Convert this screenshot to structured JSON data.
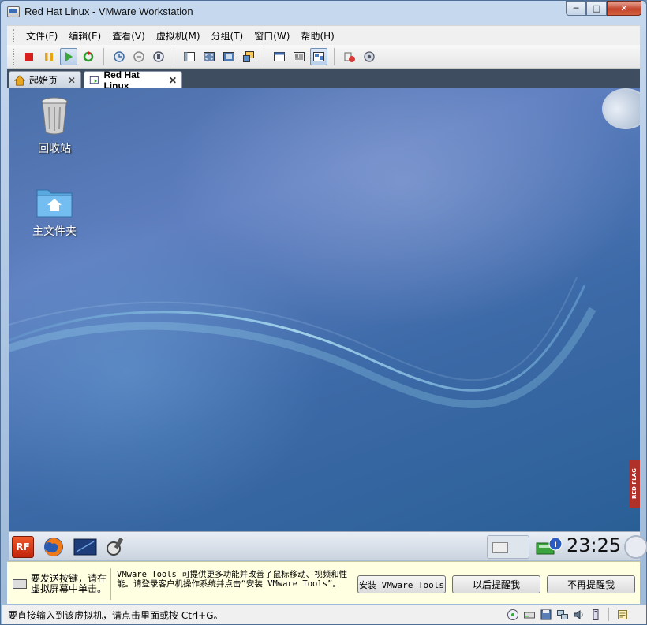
{
  "window": {
    "title": "Red Hat Linux - VMware Workstation",
    "minimize": "─",
    "maximize": "□",
    "close": "✕"
  },
  "menu": {
    "items": [
      "文件(F)",
      "编辑(E)",
      "查看(V)",
      "虚拟机(M)",
      "分组(T)",
      "窗口(W)",
      "帮助(H)"
    ]
  },
  "tabs": [
    {
      "label": "起始页",
      "close": "✕",
      "icon": "home-icon"
    },
    {
      "label": "Red Hat Linux",
      "close": "✕",
      "icon": "vm-icon"
    }
  ],
  "desktop": {
    "icons": [
      {
        "label": "回收站",
        "icon": "trash-icon"
      },
      {
        "label": "主文件夹",
        "icon": "home-folder-icon"
      }
    ],
    "side_tab": "RED FLAG"
  },
  "guest_taskbar": {
    "start": "RF",
    "clock": "23:25"
  },
  "notification": {
    "hint": "要发送按键，请在虚拟屏幕中单击。",
    "message": "VMware Tools 可提供更多功能并改善了鼠标移动、视频和性能。请登录客户机操作系统并点击“安装 VMware Tools”。",
    "install_button": "安装 VMware Tools",
    "later_button": "以后提醒我",
    "never_button": "不再提醒我"
  },
  "status": {
    "text": "要直接输入到该虚拟机，请点击里面或按 Ctrl+G。"
  },
  "colors": {
    "desktop_blue": "#3d6aa8",
    "notify_bg": "#ffffe1",
    "tab_bar": "#3f4d61"
  }
}
